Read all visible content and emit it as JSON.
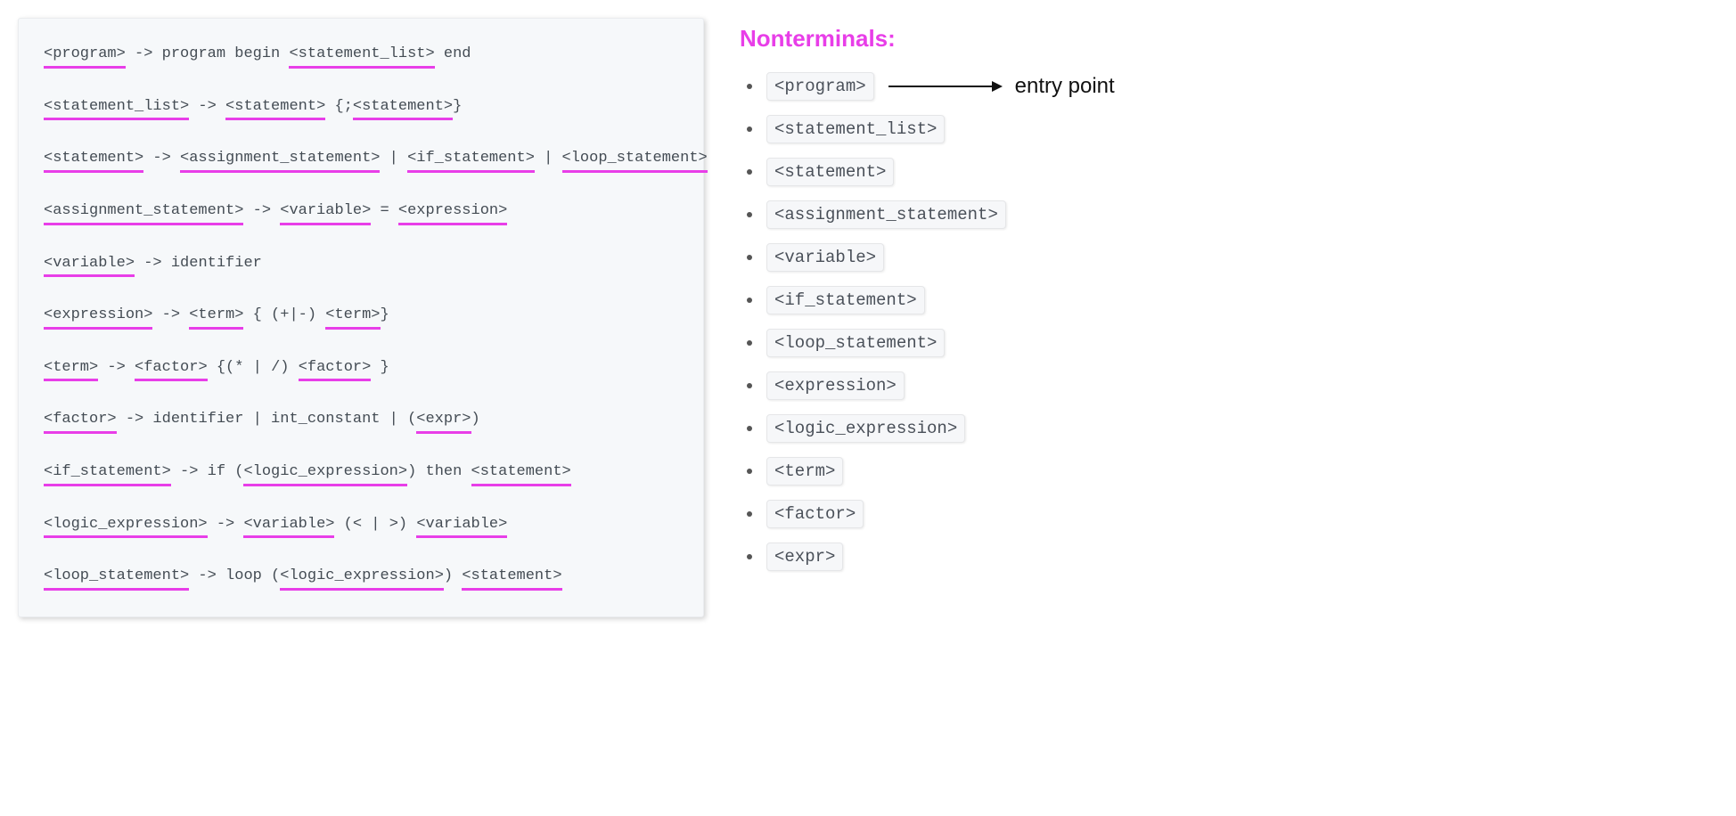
{
  "heading": "Nonterminals:",
  "entry_label": "entry point",
  "grammar_rules": [
    {
      "tokens": [
        {
          "t": "<program>",
          "u": true
        },
        {
          "t": " -> program begin "
        },
        {
          "t": "<statement_list>",
          "u": true
        },
        {
          "t": " end"
        }
      ]
    },
    {
      "tokens": [
        {
          "t": "<statement_list>",
          "u": true
        },
        {
          "t": " -> "
        },
        {
          "t": "<statement>",
          "u": true
        },
        {
          "t": " {;"
        },
        {
          "t": "<statement>",
          "u": true
        },
        {
          "t": "}"
        }
      ]
    },
    {
      "tokens": [
        {
          "t": "<statement>",
          "u": true
        },
        {
          "t": " -> "
        },
        {
          "t": "<assignment_statement>",
          "u": true
        },
        {
          "t": " | "
        },
        {
          "t": "<if_statement>",
          "u": true
        },
        {
          "t": " | "
        },
        {
          "t": "<loop_statement>",
          "u": true
        }
      ]
    },
    {
      "tokens": [
        {
          "t": "<assignment_statement>",
          "u": true
        },
        {
          "t": " -> "
        },
        {
          "t": "<variable>",
          "u": true
        },
        {
          "t": " = "
        },
        {
          "t": "<expression>",
          "u": true
        }
      ]
    },
    {
      "tokens": [
        {
          "t": "<variable>",
          "u": true
        },
        {
          "t": " -> identifier"
        }
      ]
    },
    {
      "tokens": [
        {
          "t": "<expression>",
          "u": true
        },
        {
          "t": " -> "
        },
        {
          "t": "<term>",
          "u": true
        },
        {
          "t": " { (+|-) "
        },
        {
          "t": "<term>",
          "u": true
        },
        {
          "t": "}"
        }
      ]
    },
    {
      "tokens": [
        {
          "t": "<term>",
          "u": true
        },
        {
          "t": " -> "
        },
        {
          "t": "<factor>",
          "u": true
        },
        {
          "t": " {(* | /) "
        },
        {
          "t": "<factor>",
          "u": true
        },
        {
          "t": " }"
        }
      ]
    },
    {
      "tokens": [
        {
          "t": "<factor>",
          "u": true
        },
        {
          "t": " -> identifier | int_constant | ("
        },
        {
          "t": "<expr>",
          "u": true
        },
        {
          "t": ")"
        }
      ]
    },
    {
      "tokens": [
        {
          "t": "<if_statement>",
          "u": true
        },
        {
          "t": " -> if ("
        },
        {
          "t": "<logic_expression>",
          "u": true
        },
        {
          "t": ") then "
        },
        {
          "t": "<statement>",
          "u": true
        }
      ]
    },
    {
      "tokens": [
        {
          "t": "<logic_expression>",
          "u": true
        },
        {
          "t": " -> "
        },
        {
          "t": "<variable>",
          "u": true
        },
        {
          "t": " (< | >) "
        },
        {
          "t": "<variable>",
          "u": true
        }
      ]
    },
    {
      "tokens": [
        {
          "t": "<loop_statement>",
          "u": true
        },
        {
          "t": " -> loop ("
        },
        {
          "t": "<logic_expression>",
          "u": true
        },
        {
          "t": ") "
        },
        {
          "t": "<statement>",
          "u": true
        }
      ]
    }
  ],
  "nonterminals": [
    {
      "name": "<program>",
      "entry": true
    },
    {
      "name": "<statement_list>"
    },
    {
      "name": "<statement>"
    },
    {
      "name": "<assignment_statement>"
    },
    {
      "name": "<variable>"
    },
    {
      "name": "<if_statement>"
    },
    {
      "name": "<loop_statement>"
    },
    {
      "name": "<expression>"
    },
    {
      "name": "<logic_expression>"
    },
    {
      "name": "<term>"
    },
    {
      "name": "<factor>"
    },
    {
      "name": "<expr>"
    }
  ]
}
